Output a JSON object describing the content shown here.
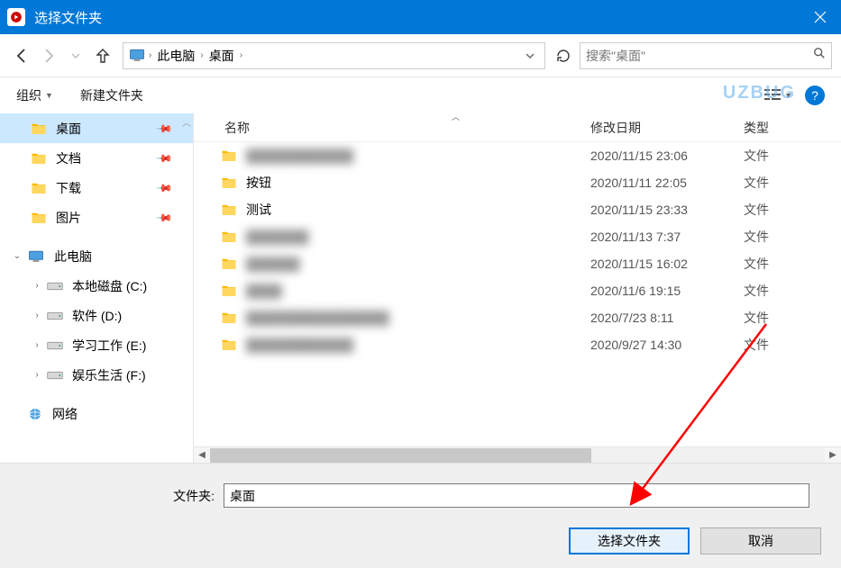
{
  "window": {
    "title": "选择文件夹"
  },
  "breadcrumb": {
    "seg1": "此电脑",
    "seg2": "桌面"
  },
  "search": {
    "placeholder": "搜索\"桌面\""
  },
  "toolbar": {
    "organize": "组织",
    "newfolder": "新建文件夹"
  },
  "watermark": "UZBUG",
  "sidebar": {
    "quick": [
      {
        "label": "桌面",
        "icon": "folder",
        "pinned": true,
        "selected": true
      },
      {
        "label": "文档",
        "icon": "folder",
        "pinned": true,
        "selected": false
      },
      {
        "label": "下载",
        "icon": "folder",
        "pinned": true,
        "selected": false
      },
      {
        "label": "图片",
        "icon": "folder",
        "pinned": true,
        "selected": false
      }
    ],
    "thispc": {
      "label": "此电脑"
    },
    "drives": [
      {
        "label": "本地磁盘 (C:)"
      },
      {
        "label": "软件 (D:)"
      },
      {
        "label": "学习工作 (E:)"
      },
      {
        "label": "娱乐生活 (F:)"
      }
    ],
    "network": {
      "label": "网络"
    }
  },
  "columns": {
    "name": "名称",
    "date": "修改日期",
    "type": "类型"
  },
  "files": [
    {
      "name": "████████████",
      "date": "2020/11/15 23:06",
      "type": "文件",
      "blur": true
    },
    {
      "name": "按钮",
      "date": "2020/11/11 22:05",
      "type": "文件",
      "blur": false
    },
    {
      "name": "测试",
      "date": "2020/11/15 23:33",
      "type": "文件",
      "blur": false
    },
    {
      "name": "███████",
      "date": "2020/11/13 7:37",
      "type": "文件",
      "blur": true
    },
    {
      "name": "██████",
      "date": "2020/11/15 16:02",
      "type": "文件",
      "blur": true
    },
    {
      "name": "████",
      "date": "2020/11/6 19:15",
      "type": "文件",
      "blur": true
    },
    {
      "name": "████████████████",
      "date": "2020/7/23 8:11",
      "type": "文件",
      "blur": true
    },
    {
      "name": "████████████",
      "date": "2020/9/27 14:30",
      "type": "文件",
      "blur": true
    }
  ],
  "footer": {
    "folder_label": "文件夹:",
    "folder_value": "桌面",
    "select_btn": "选择文件夹",
    "cancel_btn": "取消"
  }
}
